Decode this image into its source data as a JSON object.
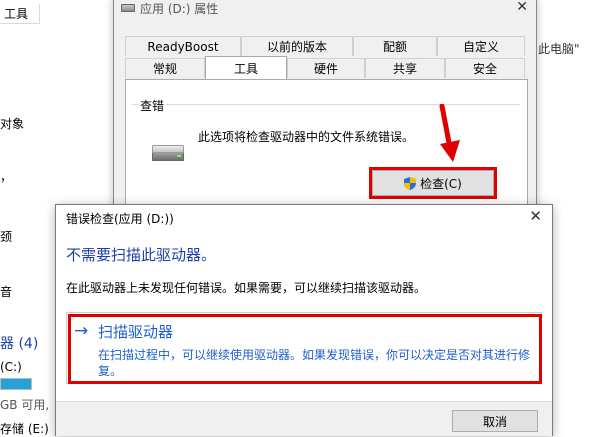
{
  "explorer": {
    "tab_label": "工具",
    "path_fragment": "此电脑\"",
    "nav_items": [
      "对象",
      "器 (4)",
      "(C:)",
      "GB 可用,",
      "存储 (E:)"
    ],
    "nav_fragments": [
      "，",
      "颈",
      "音"
    ],
    "c_drive_usage": 1.0
  },
  "props": {
    "title": "应用 (D:) 属性",
    "close_glyph": "✕",
    "tabs_row1": [
      "ReadyBoost",
      "以前的版本",
      "配额",
      "自定义"
    ],
    "tabs_row2": [
      "常规",
      "工具",
      "硬件",
      "共享",
      "安全"
    ],
    "active_tab": "工具",
    "group_label": "查错",
    "group_desc": "此选项将检查驱动器中的文件系统错误。",
    "check_button": "检查(C)"
  },
  "dialog": {
    "title": "错误检查(应用 (D:))",
    "close_glyph": "✕",
    "heading": "不需要扫描此驱动器。",
    "body": "在此驱动器上未发现任何错误。如果需要，可以继续扫描该驱动器。",
    "scan_arrow": "→",
    "scan_title": "扫描驱动器",
    "scan_desc": "在扫描过程中，可以继续使用驱动器。如果发现错误，你可以决定是否对其进行修复。",
    "cancel_button": "取消"
  },
  "colors": {
    "highlight": "#e00000",
    "link_blue": "#1f5fd0",
    "heading_blue": "#1e3fa8"
  },
  "icons": [
    "drive-icon",
    "hard-drive-icon",
    "shield-icon",
    "close-icon",
    "arrow-right-icon",
    "red-arrow-icon"
  ]
}
